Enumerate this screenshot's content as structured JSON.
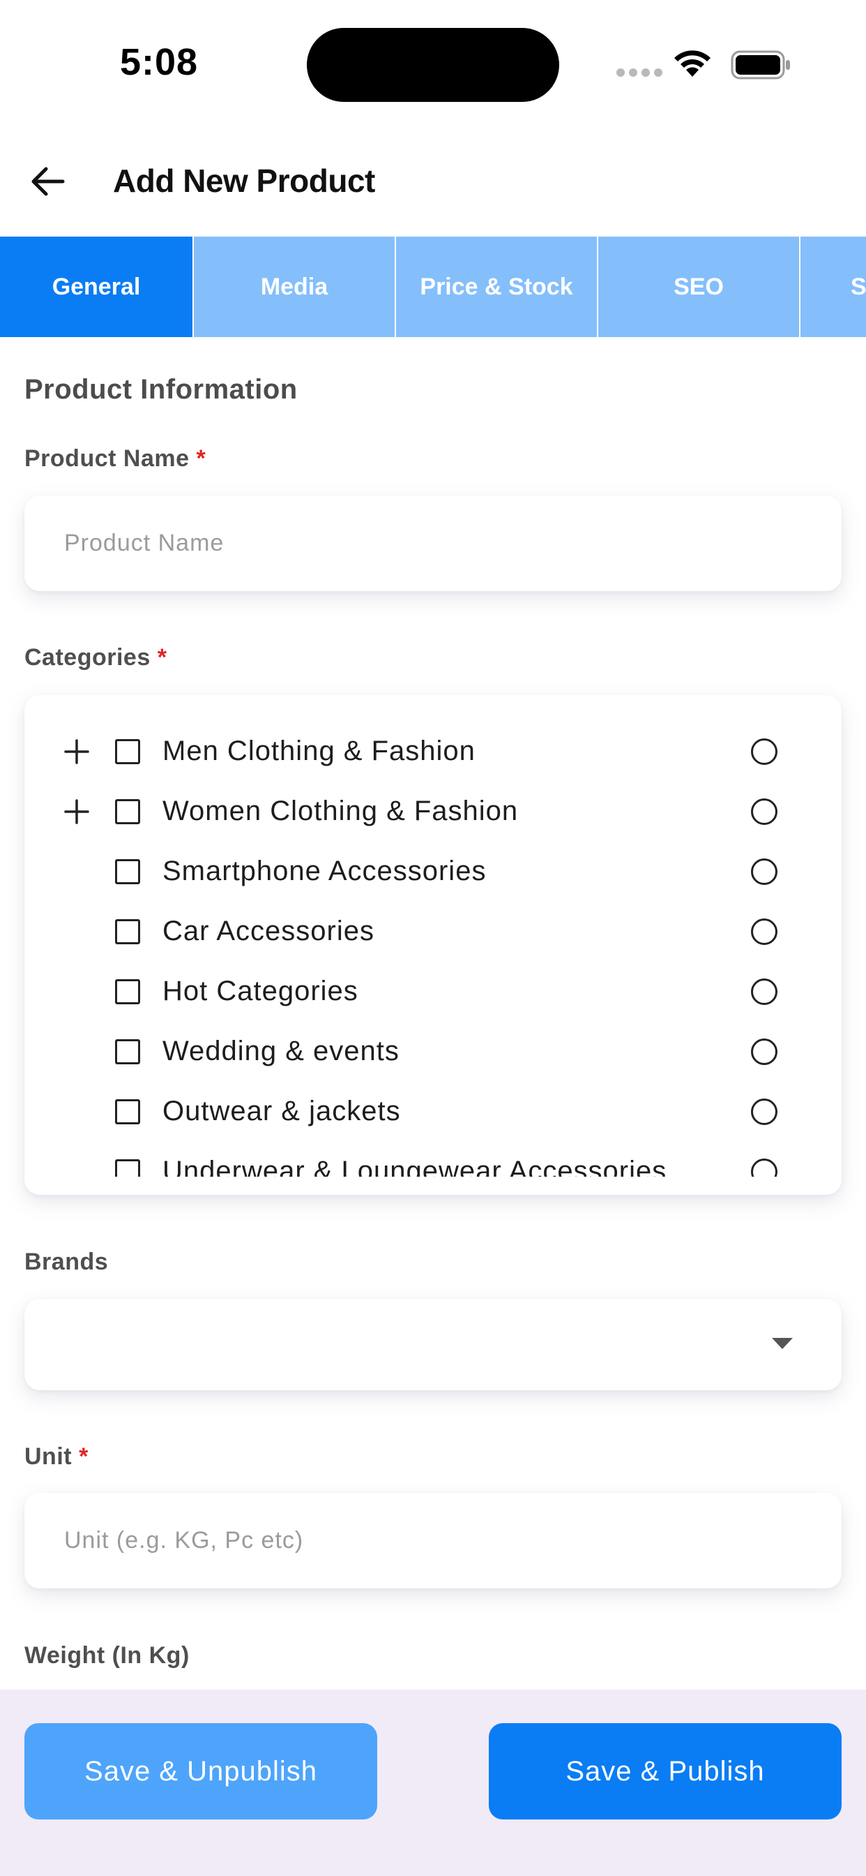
{
  "status_bar": {
    "time": "5:08"
  },
  "header": {
    "title": "Add New Product"
  },
  "tabs": [
    {
      "label": "General"
    },
    {
      "label": "Media"
    },
    {
      "label": "Price & Stock"
    },
    {
      "label": "SEO"
    },
    {
      "label": "S"
    }
  ],
  "form": {
    "section_title": "Product Information",
    "product_name": {
      "label": "Product Name",
      "required_mark": "*",
      "placeholder": "Product Name",
      "value": ""
    },
    "categories": {
      "label": "Categories",
      "required_mark": "*",
      "items": [
        {
          "label": "Men Clothing & Fashion",
          "expandable": true
        },
        {
          "label": "Women Clothing & Fashion",
          "expandable": true
        },
        {
          "label": "Smartphone Accessories",
          "expandable": false
        },
        {
          "label": "Car Accessories",
          "expandable": false
        },
        {
          "label": "Hot Categories",
          "expandable": false
        },
        {
          "label": "Wedding & events",
          "expandable": false
        },
        {
          "label": "Outwear & jackets",
          "expandable": false
        },
        {
          "label": "Underwear & Loungewear Accessories",
          "expandable": false
        }
      ]
    },
    "brands": {
      "label": "Brands",
      "value": ""
    },
    "unit": {
      "label": "Unit",
      "required_mark": "*",
      "placeholder": "Unit (e.g. KG, Pc etc)",
      "value": ""
    },
    "weight": {
      "label": "Weight (In Kg)"
    }
  },
  "actions": {
    "unpublish_label": "Save & Unpublish",
    "publish_label": "Save & Publish"
  },
  "colors": {
    "primary": "#0a7df4",
    "tab_inactive": "#84bffb",
    "secondary_button": "#4ea4fb",
    "bottom_bar": "#f1ebf8",
    "required": "#e02424"
  }
}
